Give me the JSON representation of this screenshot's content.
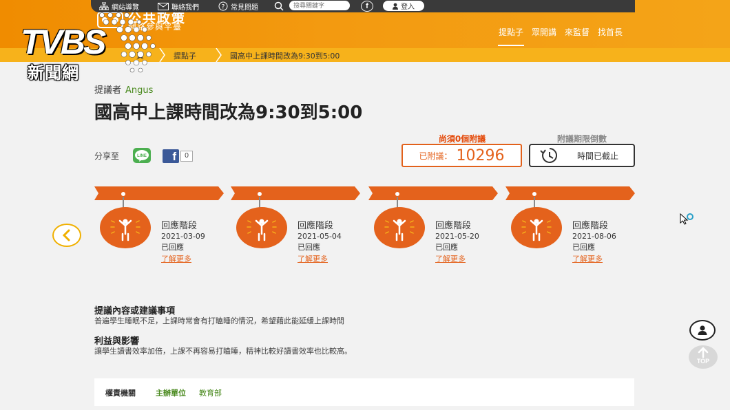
{
  "topbar": {
    "sitemap": "網站導覽",
    "contact": "聯絡我們",
    "faq": "常見問題",
    "search_placeholder": "搜尋關鍵字",
    "facebook": "f",
    "login": "登入"
  },
  "site": {
    "name": "公共政策",
    "subtitle": "網路參與平臺"
  },
  "nav": [
    "提點子",
    "眾開講",
    "來監督",
    "找首長"
  ],
  "breadcrumb": [
    "頁",
    "提點子",
    "國高中上課時間改為9:30到5:00"
  ],
  "watermark": {
    "logo": "TVBS",
    "text": "新聞網"
  },
  "proposal": {
    "proposer_label": "提議者",
    "proposer_name": "Angus",
    "title": "國高中上課時間改為9:30到5:00",
    "share_label": "分享至",
    "line_label": "LINE",
    "fb_count": "0",
    "need_label": "尚須0個附議",
    "endorse_label": "已附議：",
    "endorse_count": "10296",
    "deadline_label": "附議期限倒數",
    "deadline_status": "時間已截止"
  },
  "timeline": [
    {
      "phase": "回應階段",
      "date": "2021-03-09",
      "status": "已回應",
      "more": "了解更多"
    },
    {
      "phase": "回應階段",
      "date": "2021-05-04",
      "status": "已回應",
      "more": "了解更多"
    },
    {
      "phase": "回應階段",
      "date": "2021-05-20",
      "status": "已回應",
      "more": "了解更多"
    },
    {
      "phase": "回應階段",
      "date": "2021-08-06",
      "status": "已回應",
      "more": "了解更多"
    }
  ],
  "content": {
    "suggestion_title": "提議內容或建議事項",
    "suggestion_text": "普遍學生睡眠不足，上課時常會有打瞌睡的情況，希望藉此能延緩上課時間",
    "impact_title": "利益與影響",
    "impact_text": "讓學生讀書效率加倍，上課不再容易打瞌睡，精神比較好讀書效率也比較高。"
  },
  "authority": {
    "label": "權責機關",
    "host_label": "主辦單位",
    "host_value": "教育部"
  },
  "side": {
    "top_label": "TOP"
  },
  "colors": {
    "header_orange": "#f39a10",
    "breadcrumb_yellow": "#f7b21b",
    "accent_orange": "#e4621c",
    "proposer_green": "#4a8a1f"
  }
}
